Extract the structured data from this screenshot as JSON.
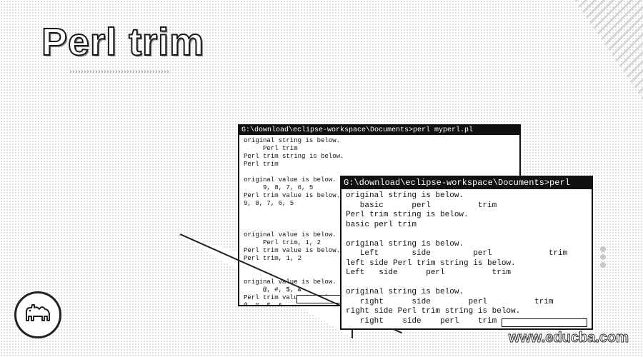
{
  "page": {
    "title": "Perl trim"
  },
  "terminal_back": {
    "titlebar": "G:\\download\\eclipse-workspace\\Documents>perl myperl.pl",
    "lines": [
      "original string is below.",
      "     Perl trim",
      "Perl trim string is below.",
      "Perl trim",
      "",
      "original value is below.",
      "     9, 8, 7, 6, 5",
      "Perl trim value is below.",
      "9, 8, 7, 6, 5",
      "",
      "",
      "",
      "original value is below.",
      "     Perl trim, 1, 2",
      "Perl trim value is below.",
      "Perl trim, 1, 2",
      "",
      "",
      "original value is below.",
      "     @, #, $, &",
      "Perl trim value is below.",
      "@, #, $, &"
    ]
  },
  "terminal_front": {
    "titlebar": "G:\\download\\eclipse-workspace\\Documents>perl",
    "lines": [
      "original string is below.",
      "   basic      perl          trim",
      "Perl trim string is below.",
      "basic perl trim",
      "",
      "original string is below.",
      "   Left       side         perl            trim",
      "left side Perl trim string is below.",
      "Left   side      perl          trim",
      "",
      "original string is below.",
      "   right      side        perl          trim",
      "right side Perl trim string is below.",
      "   right    side    perl    trim"
    ]
  },
  "logo": {
    "icon": "camel-icon"
  },
  "watermark": {
    "text": "www.educba.com"
  }
}
